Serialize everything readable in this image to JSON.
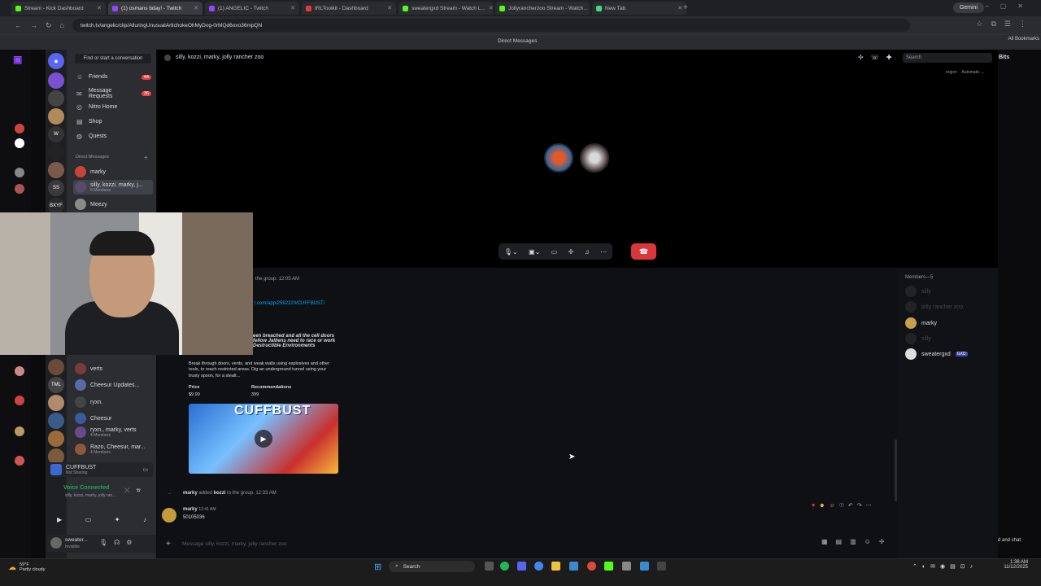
{
  "browser": {
    "tabs": [
      {
        "label": "Stream - Kick Dashboard",
        "color": "#53fc18"
      },
      {
        "label": "(1) osmans bday! - Twitch",
        "color": "#9147ff",
        "active": true
      },
      {
        "label": "(1) ANGELIC - Twitch",
        "color": "#9147ff"
      },
      {
        "label": "IRLToolkit - Dashboard",
        "color": "#e53935"
      },
      {
        "label": "sweatergxd Stream - Watch L...",
        "color": "#53fc18"
      },
      {
        "label": "Jollyrancherzoo Stream - Watch...",
        "color": "#53fc18"
      },
      {
        "label": "New Tab",
        "color": "#3ddc84"
      }
    ],
    "gemini_label": "Gemini",
    "url": "twitch.tv/angelic/clip/AlluringUnusualArtichokeOhMyDog-0rMQd6oxo36mpQN",
    "all_bookmarks": "All Bookmarks",
    "window_title": "Direct Messages"
  },
  "sidebar": {
    "find_placeholder": "Find or start a conversation",
    "nav": [
      {
        "label": "Friends",
        "icon": "friends-icon",
        "badge": "44"
      },
      {
        "label": "Message Requests",
        "icon": "mail-icon",
        "badge": "36"
      },
      {
        "label": "Nitro Home",
        "icon": "nitro-icon",
        "badge": ""
      },
      {
        "label": "Shop",
        "icon": "shop-icon",
        "badge": ""
      },
      {
        "label": "Quests",
        "icon": "quests-icon",
        "badge": ""
      }
    ],
    "dm_header": "Direct Messages",
    "dms_top": [
      {
        "name": "marky",
        "sub": ""
      },
      {
        "name": "silly, kozzi, marky, j...",
        "sub": "5 Members"
      },
      {
        "name": "Meezy",
        "sub": ""
      }
    ],
    "dms_bottom": [
      {
        "name": "verts",
        "sub": ""
      },
      {
        "name": "Cheesur Updates...",
        "sub": ""
      },
      {
        "name": "ryxn.",
        "sub": ""
      },
      {
        "name": "Cheesur",
        "sub": ""
      },
      {
        "name": "ryxn., marky, verts",
        "sub": "4 Members"
      },
      {
        "name": "Razo, Cheesur, mar...",
        "sub": "4 Members"
      }
    ],
    "activity": {
      "name": "CUFFBUST",
      "sub": "Not Sharing"
    },
    "voice_connected": "Voice Connected",
    "voice_sub": "silly, kozzi, marky, jolly ran...",
    "user_name": "sweater...",
    "user_status": "Invisible"
  },
  "call": {
    "channel_title": "silly, kozzi, marky, jolly rancher zoo",
    "search_placeholder": "Search",
    "bits": "Bits",
    "region_label": "region",
    "region_value": "Automatic"
  },
  "chat": {
    "system_fragment": "the group.",
    "system_time": "12:05 AM",
    "link_fragment": "l.com/app/2592220/CUFFBUST/",
    "embed": {
      "title_line1": "een breached and all the cell doors",
      "title_line2": "fellow Jailiens need to race or work",
      "title_line3": "Destructible Environments",
      "desc": "Break through doors, vents, and weak walls using explosives and other tools, to reach restricted areas. Dig an underground tunnel using your trusty spoon, for a stealt...",
      "price_label": "Price",
      "price_value": "$9.99",
      "rec_label": "Recommendations",
      "rec_value": "399",
      "game_title": "CUFFBUST"
    },
    "added_actor": "marky",
    "added_text": " added ",
    "added_target": "kozzi",
    "added_suffix": " to the group.",
    "added_time": "12:33 AM",
    "msg_author": "marky",
    "msg_time": "12:41 AM",
    "msg_text": "50105036",
    "composer_placeholder": "Message silly, kozzi, marky, jolly rancher zoo"
  },
  "members": {
    "header": "Members—5",
    "list": [
      {
        "name": "silly",
        "dim": true
      },
      {
        "name": "jolly rancher zoo",
        "dim": true
      },
      {
        "name": "marky",
        "dim": false
      },
      {
        "name": "silly",
        "dim": true
      },
      {
        "name": "sweatergxd",
        "dim": false,
        "tag": "GXD"
      }
    ]
  },
  "overlay": {
    "right_text": "d and chat"
  },
  "taskbar": {
    "weather_temp": "59°F",
    "weather_desc": "Partly cloudy",
    "search_label": "Search",
    "time": "1:38 AM",
    "date": "11/12/2025"
  }
}
